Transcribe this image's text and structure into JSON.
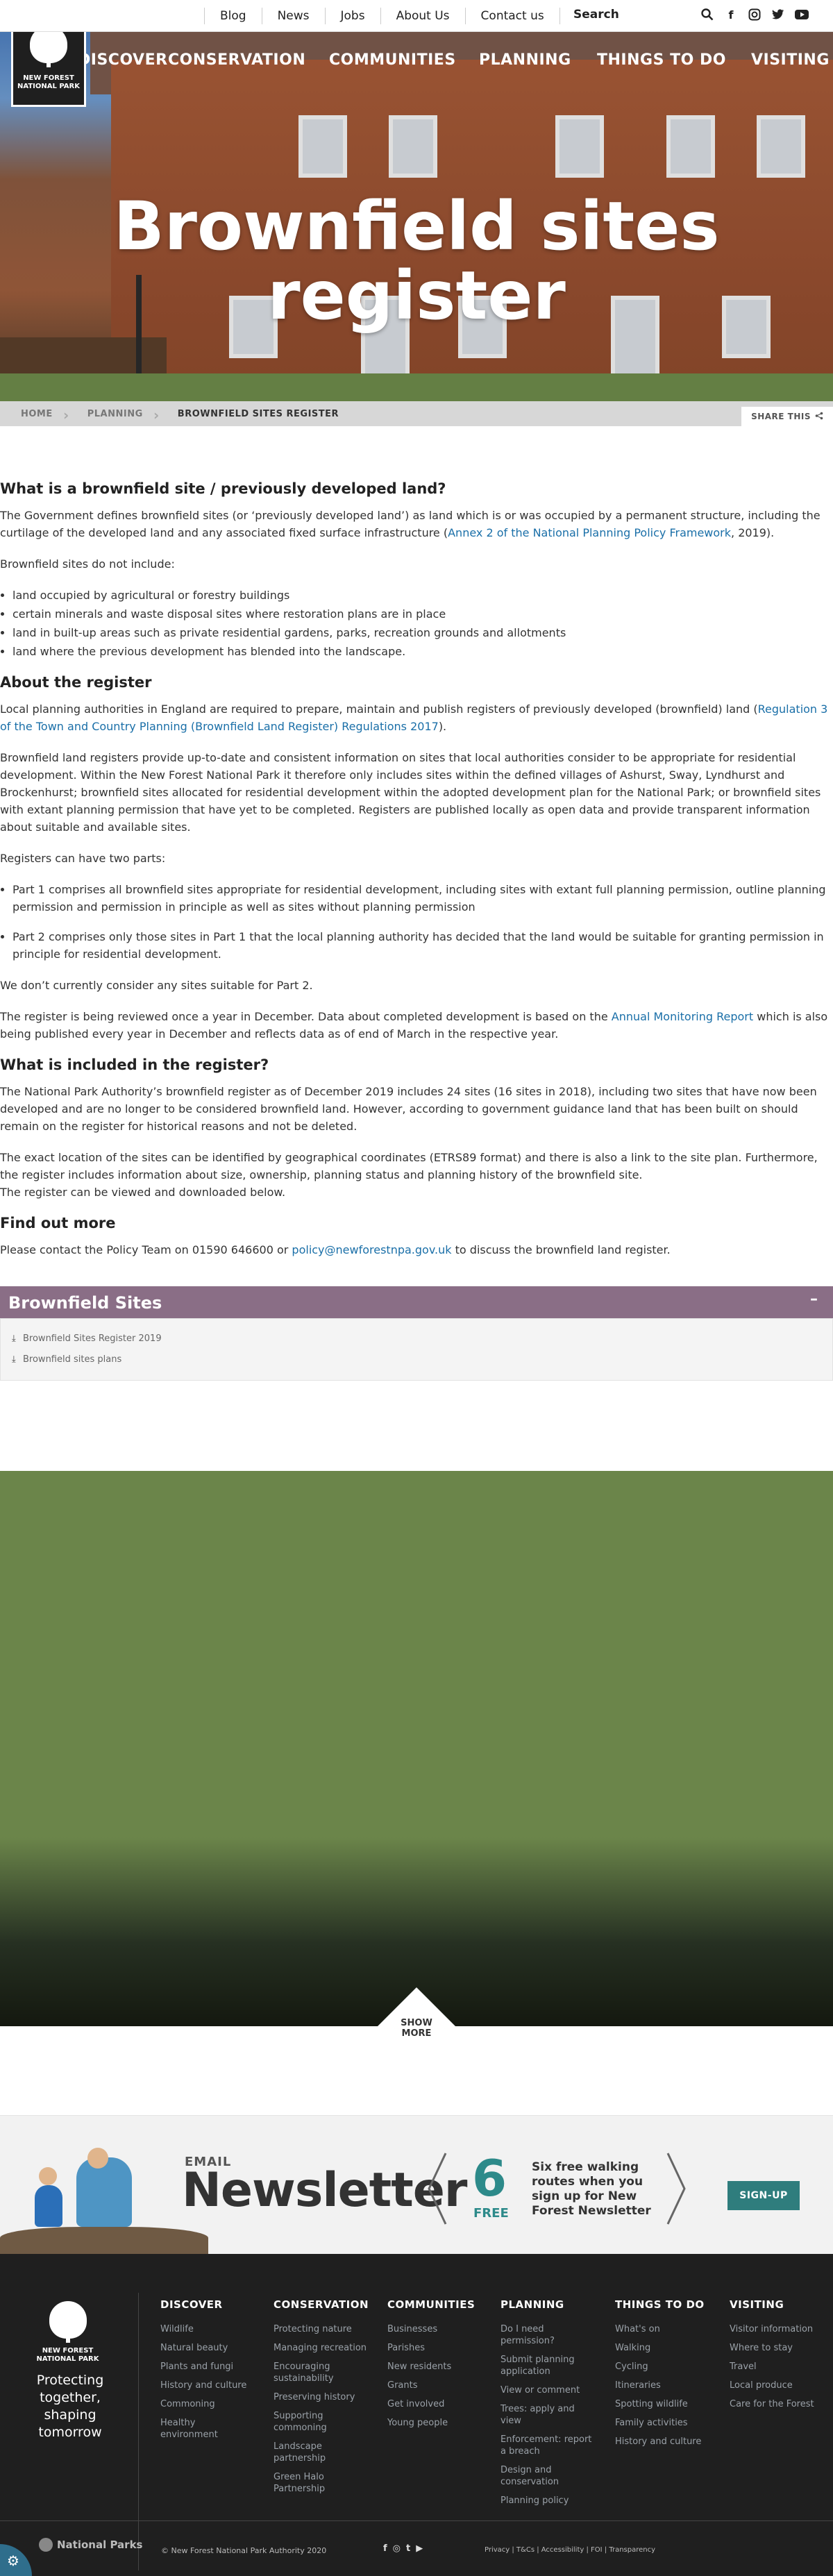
{
  "topbar": {
    "links": [
      "Blog",
      "News",
      "Jobs",
      "About Us",
      "Contact us"
    ],
    "search_label": "Search",
    "icons": [
      "search-icon",
      "facebook-icon",
      "instagram-icon",
      "twitter-icon",
      "youtube-icon"
    ]
  },
  "logo": {
    "text": "NEW FOREST NATIONAL PARK"
  },
  "mainnav": [
    "DISCOVER",
    "CONSERVATION",
    "COMMUNITIES",
    "PLANNING",
    "THINGS TO DO",
    "VISITING"
  ],
  "hero": {
    "title": "Brownfield sites register"
  },
  "breadcrumb": [
    "HOME",
    "PLANNING",
    "BROWNFIELD SITES REGISTER"
  ],
  "share_label": "SHARE THIS",
  "content": {
    "h1": "What is a brownfield site / previously developed land?",
    "p1_before": "The Government defines brownfield sites (or ‘previously developed land’) as land which is or was occupied by a permanent structure, including the curtilage of the developed land and any associated fixed surface infrastructure (",
    "p1_link": "Annex 2 of the National Planning Policy Framework",
    "p1_after": ", 2019).",
    "p2": "Brownfield sites do not include:",
    "exclusions": [
      "land occupied by agricultural or forestry buildings",
      "certain minerals and waste disposal sites where restoration plans are in place",
      "land in built-up areas such as private residential gardens, parks, recreation grounds and allotments",
      "land where the previous development has blended into the landscape."
    ],
    "h2": "About the register",
    "p3_before": "Local planning authorities in England are required to prepare, maintain and publish registers of previously developed (brownfield) land (",
    "p3_link": "Regulation 3 of the Town and Country Planning (Brownfield Land Register) Regulations 2017",
    "p3_after": ").",
    "p4": "Brownfield land registers provide up-to-date and consistent information on sites that local authorities consider to be appropriate for residential development. Within the New Forest National Park it therefore only includes sites within the defined villages of Ashurst, Sway, Lyndhurst and Brockenhurst; brownfield sites allocated for residential development within the adopted development plan for the National Park; or brownfield sites with extant planning permission that have yet to be completed. Registers are published locally as open data and provide transparent information about suitable and available sites.",
    "p5": "Registers can have two parts:",
    "parts": [
      "Part 1 comprises all brownfield sites appropriate for residential development, including sites with extant full planning permission, outline planning permission and permission in principle as well as sites without planning permission",
      "Part 2 comprises only those sites in Part 1 that the local planning authority has decided that the land would be suitable for granting permission in principle for residential development."
    ],
    "p6": "We don’t currently consider any sites suitable for Part 2.",
    "p7_before": "The register is being reviewed once a year in December. Data about completed development is based on the ",
    "p7_link": "Annual Monitoring Report",
    "p7_after": " which is also being published every year in December and reflects data as of end of March in the respective year.",
    "h3": "What is included in the register?",
    "p8": "The National Park Authority’s brownfield register as of December 2019 includes 24 sites (16 sites in 2018), including two sites that have now been developed and are no longer to be considered brownfield land. However, according to government guidance land that has been built on should remain on the register for historical reasons and not be deleted.",
    "p9": "The exact location of the sites can be identified by geographical coordinates (ETRS89 format) and there is also a link to the site plan. Furthermore, the register includes information about size, ownership, planning status and planning history of the brownfield site.",
    "p10": "The register can be viewed and downloaded below.",
    "h4": "Find out more",
    "p11_before": "Please contact the Policy Team on 01590 646600 or ",
    "p11_link": "policy@newforestnpa.gov.uk",
    "p11_after": " to discuss the brownfield land register."
  },
  "accordion": {
    "title": "Brownfield Sites",
    "toggle": "–",
    "downloads": [
      "Brownfield Sites Register 2019",
      "Brownfield sites plans"
    ]
  },
  "show_more": {
    "line1": "SHOW",
    "line2": "MORE"
  },
  "newsletter": {
    "email_label": "EMAIL",
    "title": "Newsletter",
    "number": "6",
    "free": "FREE",
    "text": "Six free walking routes when you sign up for New Forest Newsletter",
    "button": "SIGN-UP"
  },
  "footer": {
    "logo_text": "NEW FOREST NATIONAL PARK",
    "tagline": "Protecting together, shaping tomorrow",
    "columns": [
      {
        "title": "DISCOVER",
        "links": [
          "Wildlife",
          "Natural beauty",
          "Plants and fungi",
          "History and culture",
          "Commoning",
          "Healthy environment"
        ]
      },
      {
        "title": "CONSERVATION",
        "links": [
          "Protecting nature",
          "Managing recreation",
          "Encouraging sustainability",
          "Preserving history",
          "Supporting commoning",
          "Landscape partnership",
          "Green Halo Partnership"
        ]
      },
      {
        "title": "COMMUNITIES",
        "links": [
          "Businesses",
          "Parishes",
          "New residents",
          "Grants",
          "Get involved",
          "Young people"
        ]
      },
      {
        "title": "PLANNING",
        "links": [
          "Do I need permission?",
          "Submit planning application",
          "View or comment",
          "Trees: apply and view",
          "Enforcement: report a breach",
          "Design and conservation",
          "Planning policy"
        ]
      },
      {
        "title": "THINGS TO DO",
        "links": [
          "What's on",
          "Walking",
          "Cycling",
          "Itineraries",
          "Spotting wildlife",
          "Family activities",
          "History and culture"
        ]
      },
      {
        "title": "VISITING",
        "links": [
          "Visitor information",
          "Where to stay",
          "Travel",
          "Local produce",
          "Care for the Forest"
        ]
      }
    ],
    "national_parks": "National Parks",
    "copyright": "© New Forest National Park Authority 2020",
    "social": [
      "f",
      "◎",
      "t",
      "▶"
    ],
    "legal": "Privacy | T&Cs | Accessibility | FOI | Transparency"
  }
}
